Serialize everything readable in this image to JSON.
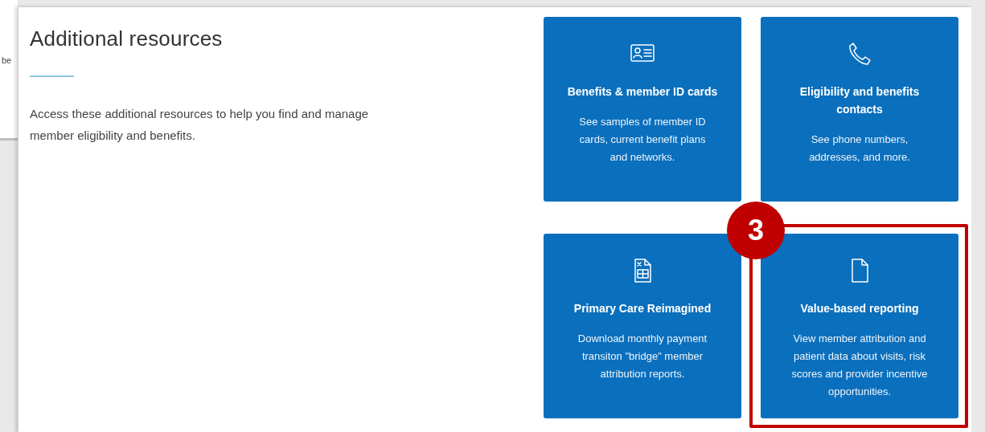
{
  "background_fragment": "be",
  "panel": {
    "title": "Additional resources",
    "description": "Access these additional resources to help you find and manage member eligibility and benefits."
  },
  "cards": [
    {
      "kind": "idcard",
      "title": "Benefits & member ID cards",
      "description": "See samples of member ID cards, current benefit plans and networks.",
      "highlighted": false
    },
    {
      "kind": "phone",
      "title": "Eligibility and benefits contacts",
      "description": "See phone numbers, addresses, and more.",
      "highlighted": false
    },
    {
      "kind": "spreadsheet",
      "title": "Primary Care Reimagined",
      "description": "Download monthly payment transiton \"bridge\" member attribution reports.",
      "highlighted": false
    },
    {
      "kind": "document",
      "title": "Value-based reporting",
      "description": "View member attribution and patient data about visits, risk scores and provider incentive opportunities.",
      "highlighted": true,
      "callout": "3"
    }
  ]
}
